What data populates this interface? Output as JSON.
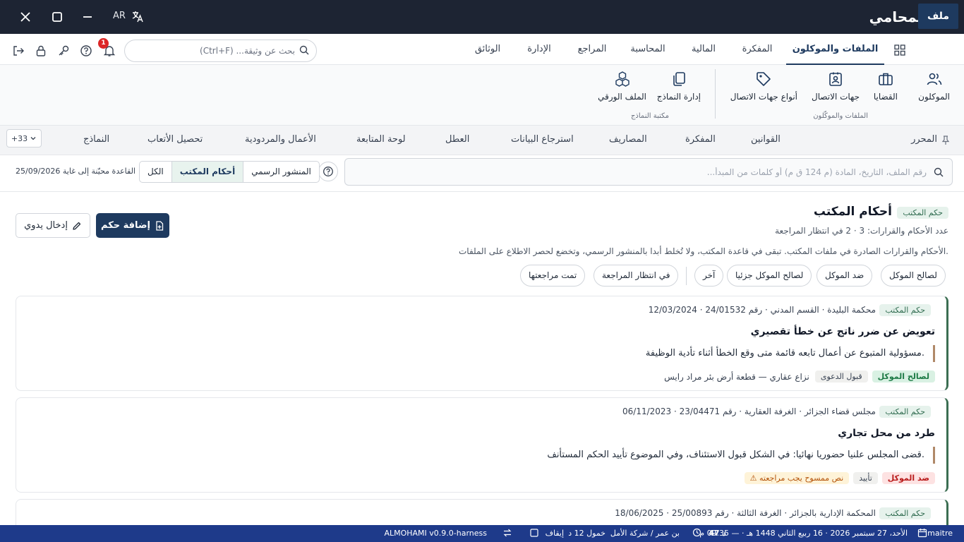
{
  "titlebar": {
    "app_name": "المحامي",
    "lang": "AR",
    "colors": {
      "bg": "#1d2433",
      "logo_green": "#2fb36b"
    }
  },
  "menubar": {
    "file_label": "ملف",
    "tabs": [
      {
        "label": "الملفات والموكلون",
        "active": true
      },
      {
        "label": "المفكرة"
      },
      {
        "label": "المالية"
      },
      {
        "label": "المحاسبة"
      },
      {
        "label": "المراجع"
      },
      {
        "label": "الإدارة"
      },
      {
        "label": "الوثائق"
      }
    ],
    "search_placeholder": "بحث عن وثيقة... (Ctrl+F)",
    "notification_count": "1"
  },
  "ribbon": {
    "buttons": [
      {
        "label": "الموكلون",
        "icon": "users-icon"
      },
      {
        "label": "القضايا",
        "icon": "briefcase-icon"
      },
      {
        "label": "جهات الاتصال",
        "icon": "contact-card-icon"
      },
      {
        "label": "أنواع جهات الاتصال",
        "icon": "tag-icon"
      },
      {
        "label": "إدارة النماذج",
        "icon": "templates-icon"
      },
      {
        "label": "الملف الورقي",
        "icon": "cubes-icon"
      }
    ],
    "groups": [
      {
        "label": "الملفات والموكّلون"
      },
      {
        "label": "مكتبة النماذج"
      }
    ]
  },
  "subtabs": {
    "pin_label": "المحرر",
    "items": [
      {
        "label": "القوانين"
      },
      {
        "label": "المفكرة"
      },
      {
        "label": "المصاريف"
      },
      {
        "label": "استرجاع البيانات"
      },
      {
        "label": "العطل"
      },
      {
        "label": "لوحة المتابعة"
      },
      {
        "label": "الأعمال والمردودية"
      },
      {
        "label": "تحصيل الأتعاب"
      },
      {
        "label": "النماذج"
      }
    ],
    "more_label": "+33"
  },
  "filters": {
    "search_placeholder": "رقم الملف، التاريخ، المادة (م 124 ق م) أو كلمات من المبدأ...",
    "segments": [
      {
        "label": "المنشور الرسمي"
      },
      {
        "label": "أحكام المكتب",
        "active": true
      },
      {
        "label": "الكل"
      }
    ],
    "db_note": "القاعدة محيّنة إلى غاية 25/09/2026"
  },
  "section": {
    "chip": "حكم المكتب",
    "title": "أحكام المكتب",
    "count_text": "عدد الأحكام والقرارات: 3 · 2 في انتظار المراجعة",
    "add_button": "إضافة حكم",
    "manual_button": "إدخال يدوي",
    "description": "الأحكام والقرارات الصادرة في ملفات المكتب. تبقى في قاعدة المكتب، ولا تُخلط أبدا بالمنشور الرسمي، وتخضع لحصر الاطلاع على الملفات.",
    "pills": [
      {
        "label": "لصالح الموكل"
      },
      {
        "label": "ضد الموكل"
      },
      {
        "label": "لصالح الموكل جزئيا"
      },
      {
        "label": "آخر"
      },
      {
        "label": "في انتظار المراجعة"
      },
      {
        "label": "تمت مراجعتها"
      }
    ]
  },
  "cards": [
    {
      "chip": "حكم المكتب",
      "meta": "محكمة البليدة · القسم المدني · رقم 24/01532 · 12/03/2024",
      "title": "تعويض عن ضرر ناتج عن خطأ تقصيري",
      "quote": "مسؤولية المتبوع عن أعمال تابعه قائمة متى وقع الخطأ أثناء تأدية الوظيفة.",
      "tags": [
        {
          "label": "لصالح الموكل",
          "kind": "client"
        },
        {
          "label": "قبول الدعوى",
          "kind": "neutral"
        }
      ],
      "extra": "نزاع عقاري — قطعة أرض بئر مراد رايس"
    },
    {
      "chip": "حكم المكتب",
      "meta": "مجلس قضاء الجزائر · الغرفة العقارية · رقم 23/04471 · 06/11/2023",
      "title": "طرد من محل تجاري",
      "quote": "قضى المجلس علنيا حضوريا نهائيا: في الشكل قبول الاستئناف، وفي الموضوع تأييد الحكم المستأنف.",
      "tags": [
        {
          "label": "ضد الموكل",
          "kind": "against"
        },
        {
          "label": "تأييد",
          "kind": "neutral"
        },
        {
          "label": "⚠ نص ممسوح يجب مراجعته",
          "kind": "warn"
        }
      ],
      "extra": ""
    },
    {
      "chip": "حكم المكتب",
      "meta": "المحكمة الإدارية بالجزائر · الغرفة الثالثة · رقم 25/00893 · 18/06/2025"
    }
  ],
  "statusbar": {
    "user": "maitre",
    "date": "الأحد، 27 سبتمبر 2026 · 16 ربيع الثاني 1448 هـ · — 09.35 م",
    "timer": "47 د",
    "office": "بن عمر / شركة الأمل",
    "idle": "خمول 12 د",
    "pause": "إيقاف",
    "version": "ALMOHAMI v0.9.0-harness"
  }
}
